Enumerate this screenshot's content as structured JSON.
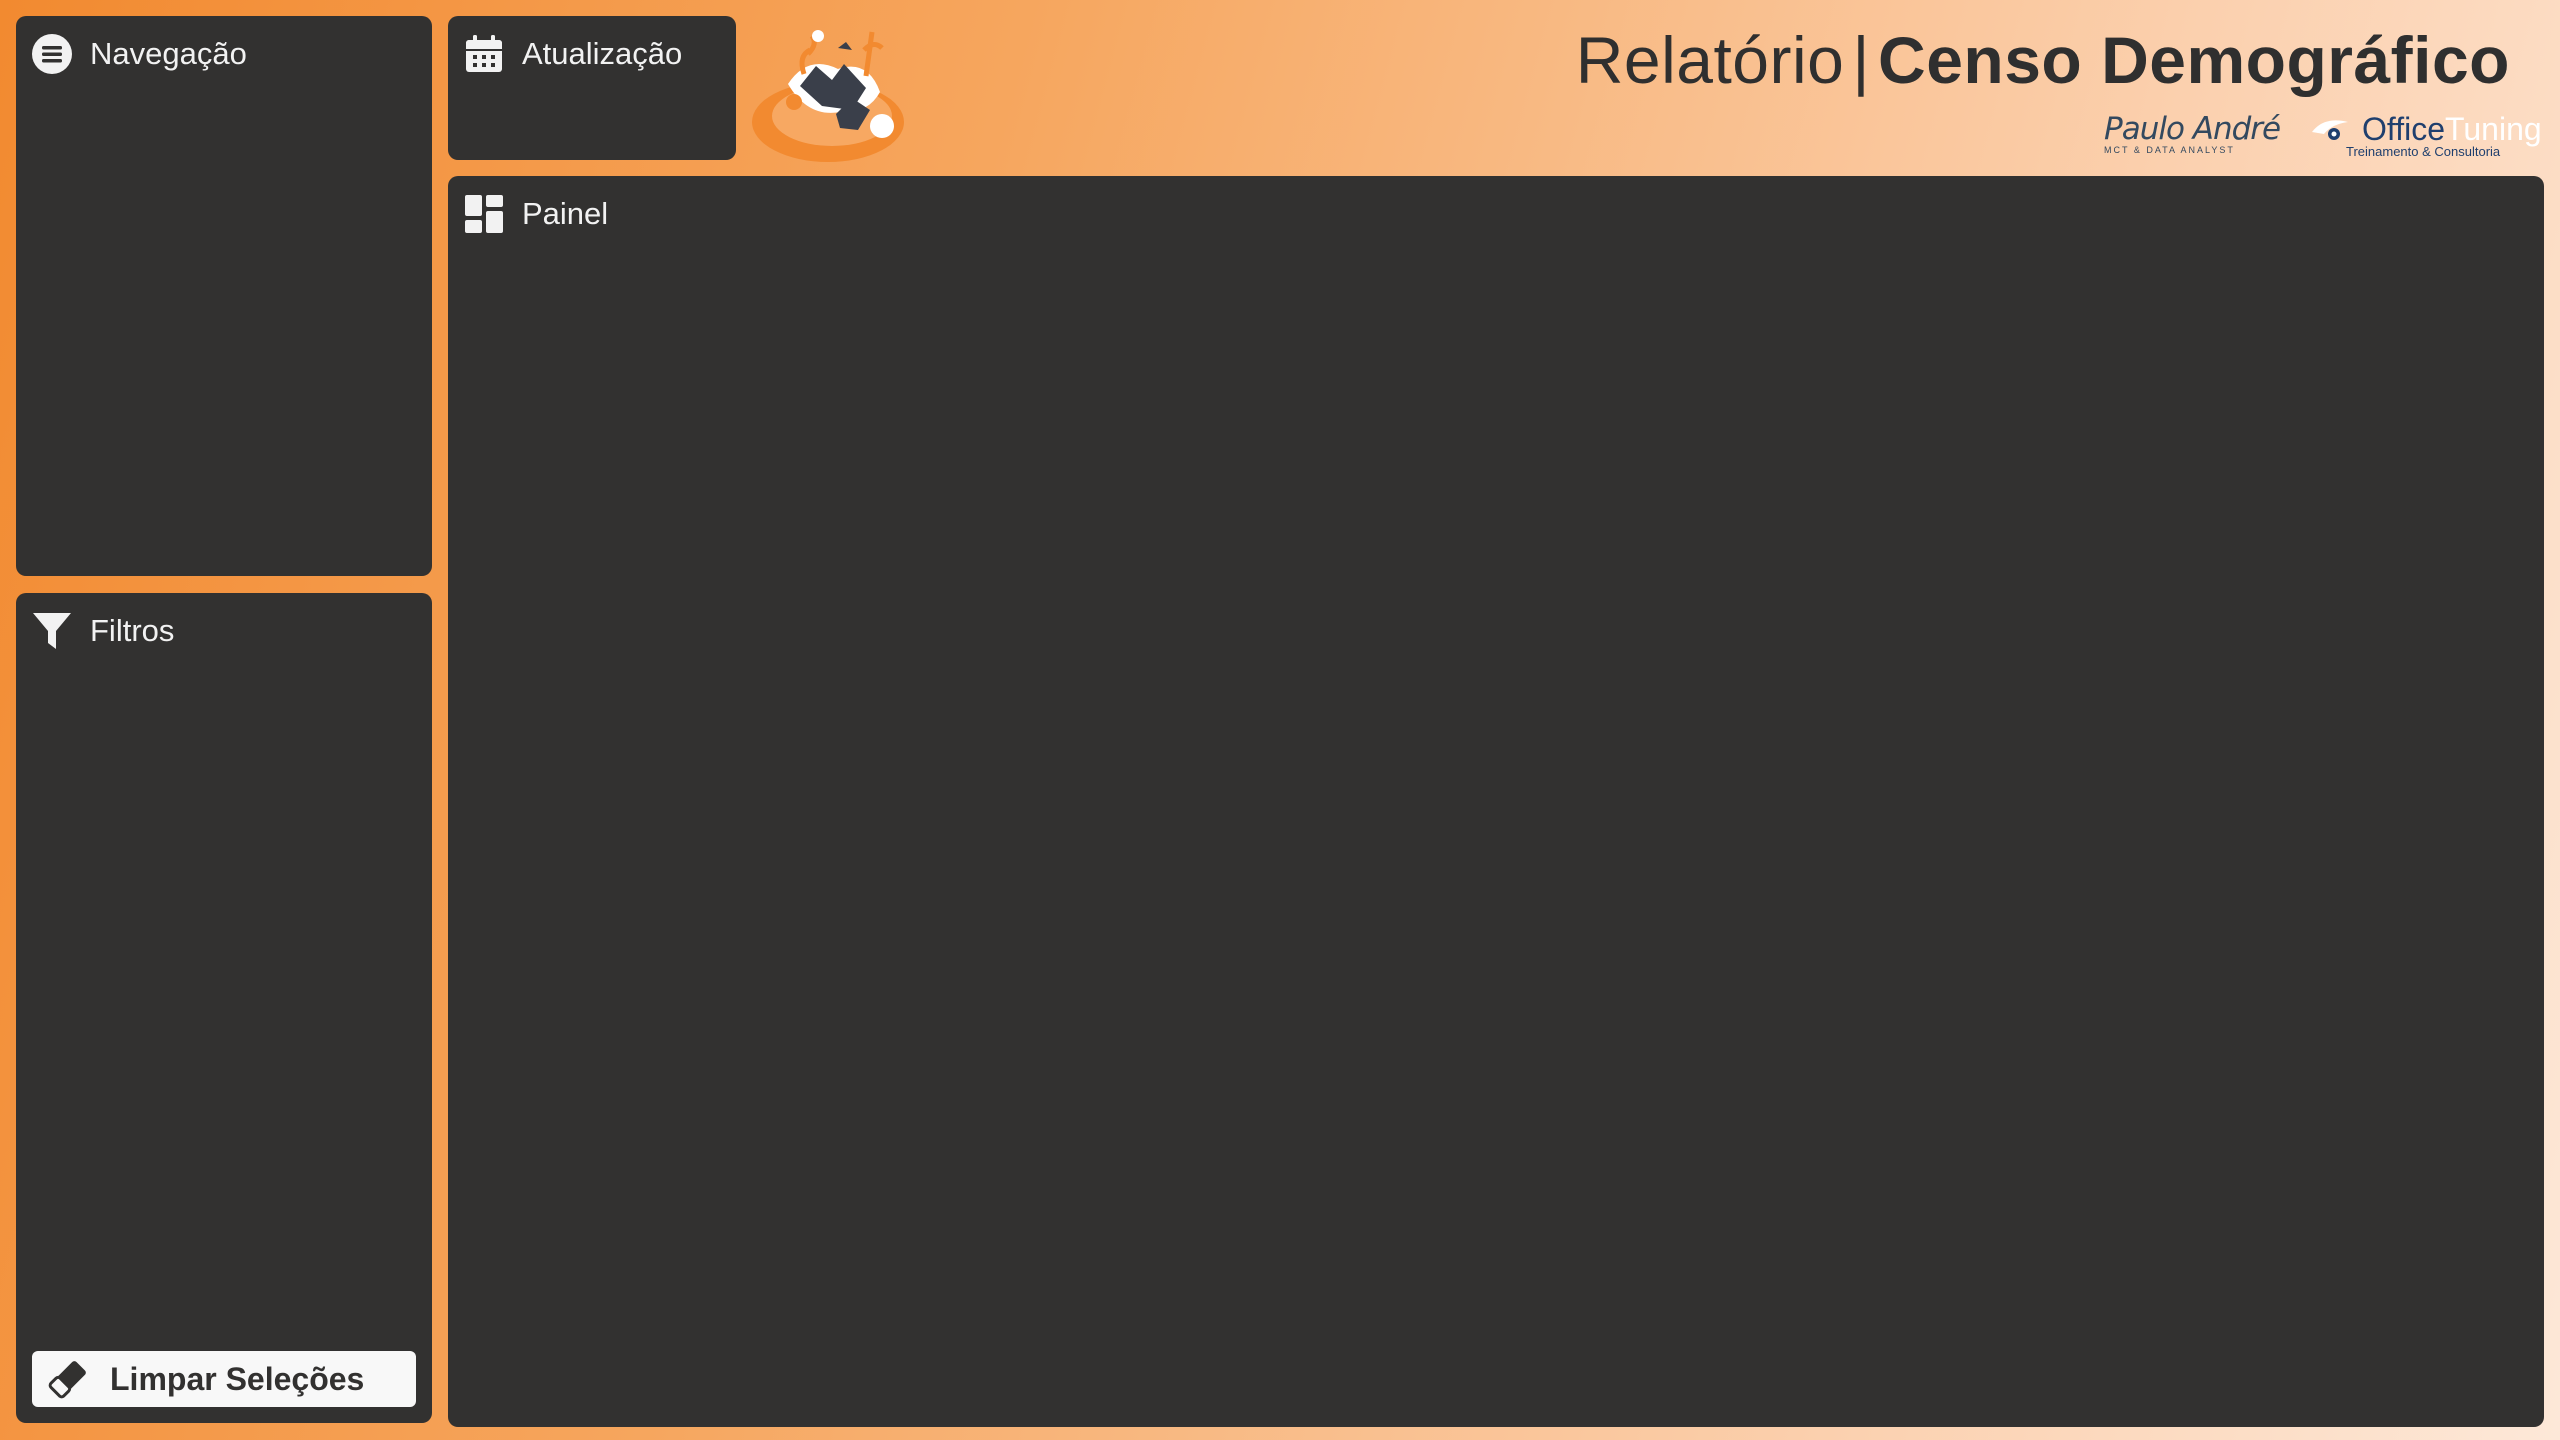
{
  "nav": {
    "title": "Navegação",
    "icon": "menu-icon"
  },
  "filters": {
    "title": "Filtros",
    "icon": "filter-icon",
    "clear_label": "Limpar Seleções",
    "clear_icon": "eraser-icon"
  },
  "update": {
    "title": "Atualização",
    "icon": "calendar-icon"
  },
  "dashboard": {
    "title": "Painel",
    "icon": "dashboard-icon"
  },
  "header": {
    "title_light": "Relatório",
    "separator": "|",
    "title_bold": "Censo Demográfico"
  },
  "logos": {
    "paulo_name": "Paulo André",
    "paulo_sub": "MCT & DATA ANALYST",
    "office_name_1": "Office",
    "office_name_2": "Tuning",
    "office_sub": "Treinamento & Consultoria"
  },
  "colors": {
    "panel": "#323130",
    "accent": "#f28a30",
    "text_dark": "#2f2f2f",
    "text_light": "#f2f2f2"
  }
}
